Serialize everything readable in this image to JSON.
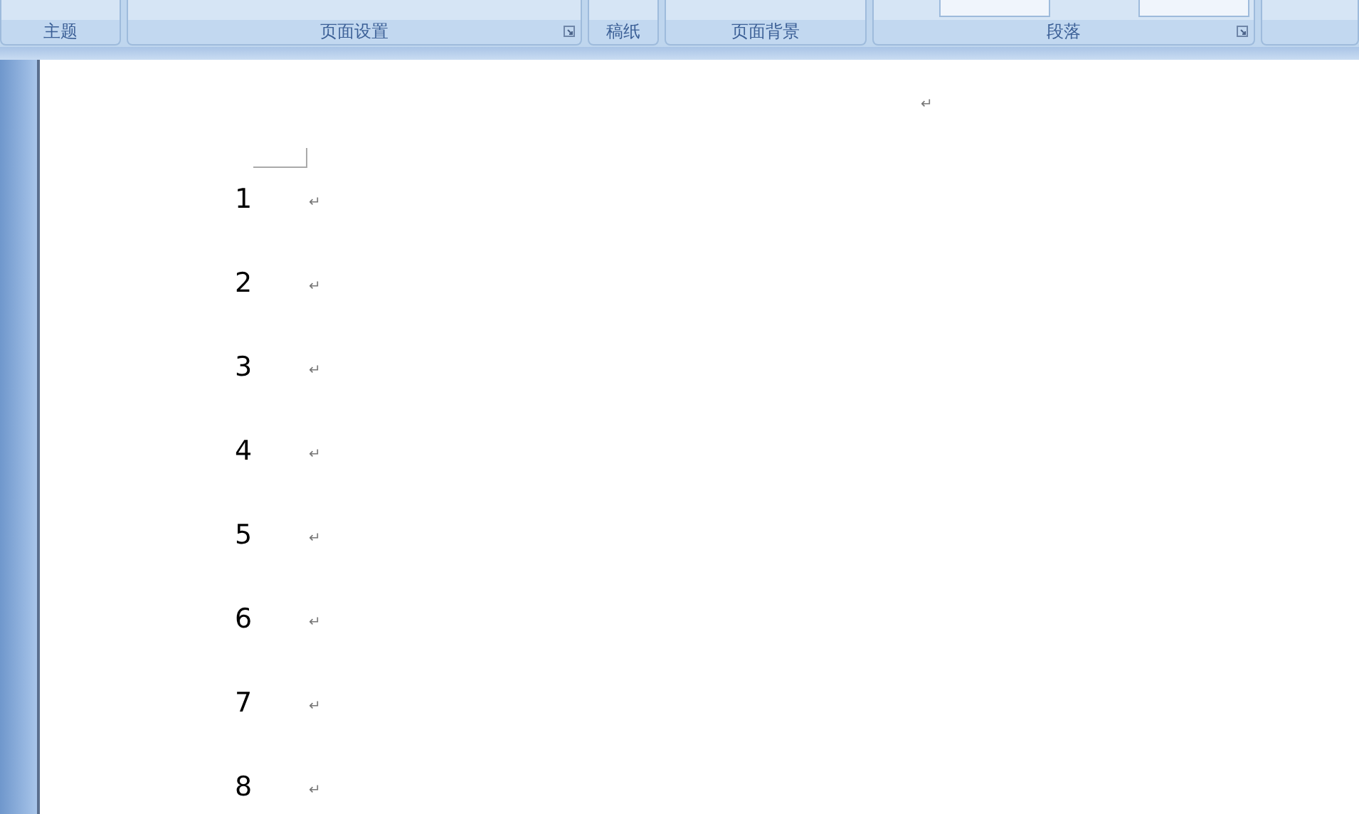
{
  "ribbon": {
    "groups": [
      {
        "label": "主题",
        "launcher": false
      },
      {
        "label": "页面设置",
        "launcher": true
      },
      {
        "label": "稿纸",
        "launcher": false
      },
      {
        "label": "页面背景",
        "launcher": false
      },
      {
        "label": "段落",
        "launcher": true
      },
      {
        "launcher": false
      }
    ]
  },
  "document": {
    "top_mark": "↵",
    "lines": [
      {
        "number": "1",
        "mark": "↵"
      },
      {
        "number": "2",
        "mark": "↵"
      },
      {
        "number": "3",
        "mark": "↵"
      },
      {
        "number": "4",
        "mark": "↵"
      },
      {
        "number": "5",
        "mark": "↵"
      },
      {
        "number": "6",
        "mark": "↵"
      },
      {
        "number": "7",
        "mark": "↵"
      },
      {
        "number": "8",
        "mark": "↵"
      }
    ]
  }
}
